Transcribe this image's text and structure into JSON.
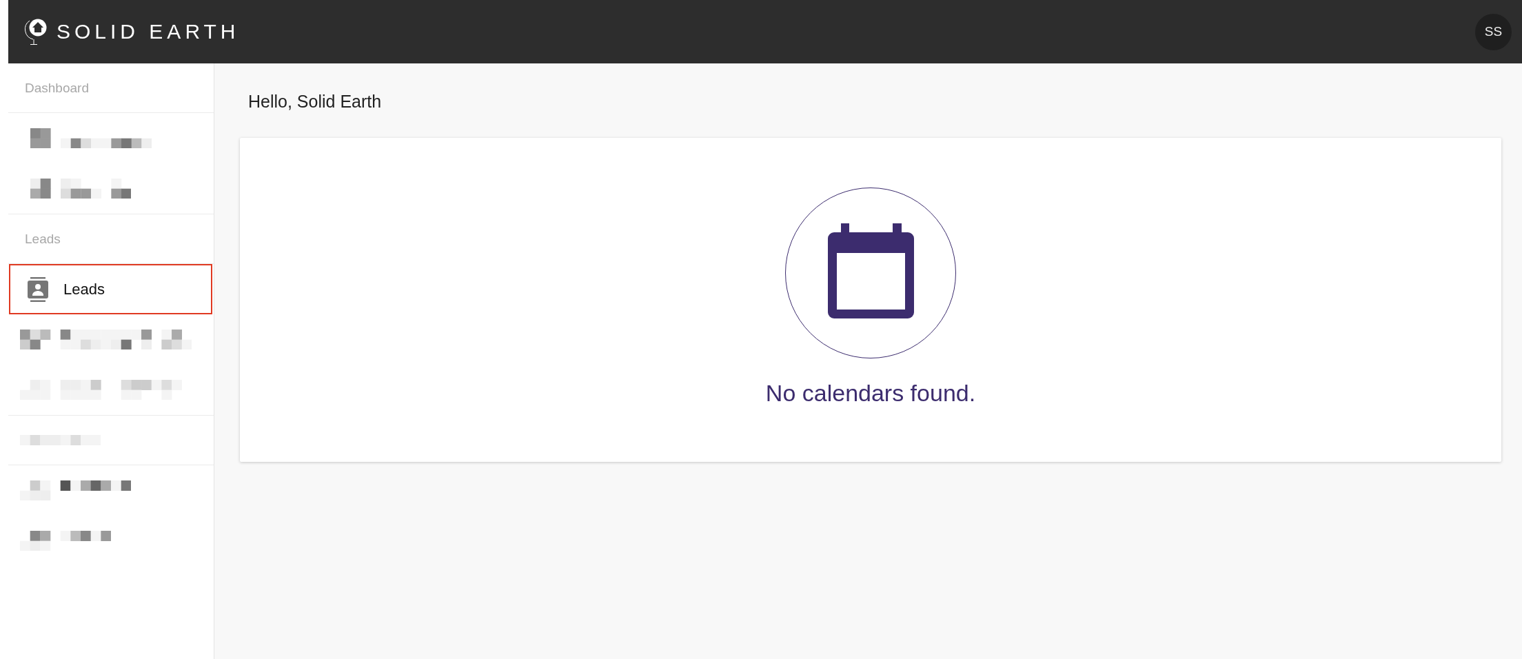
{
  "header": {
    "logo_text": "SOLID EARTH",
    "avatar_initials": "SS"
  },
  "sidebar": {
    "sections": [
      {
        "header": {
          "kind": "text",
          "label": "Dashboard"
        },
        "items": [
          {
            "kind": "redacted"
          },
          {
            "kind": "redacted"
          }
        ]
      },
      {
        "header": {
          "kind": "text",
          "label": "Leads"
        },
        "items": [
          {
            "kind": "link",
            "label": "Leads",
            "highlighted": true
          },
          {
            "kind": "redacted"
          },
          {
            "kind": "redacted"
          }
        ]
      },
      {
        "header": {
          "kind": "redacted"
        },
        "items": [
          {
            "kind": "redacted"
          },
          {
            "kind": "redacted"
          }
        ]
      }
    ]
  },
  "main": {
    "greeting": "Hello, Solid Earth",
    "empty_state": {
      "message": "No calendars found."
    }
  }
}
